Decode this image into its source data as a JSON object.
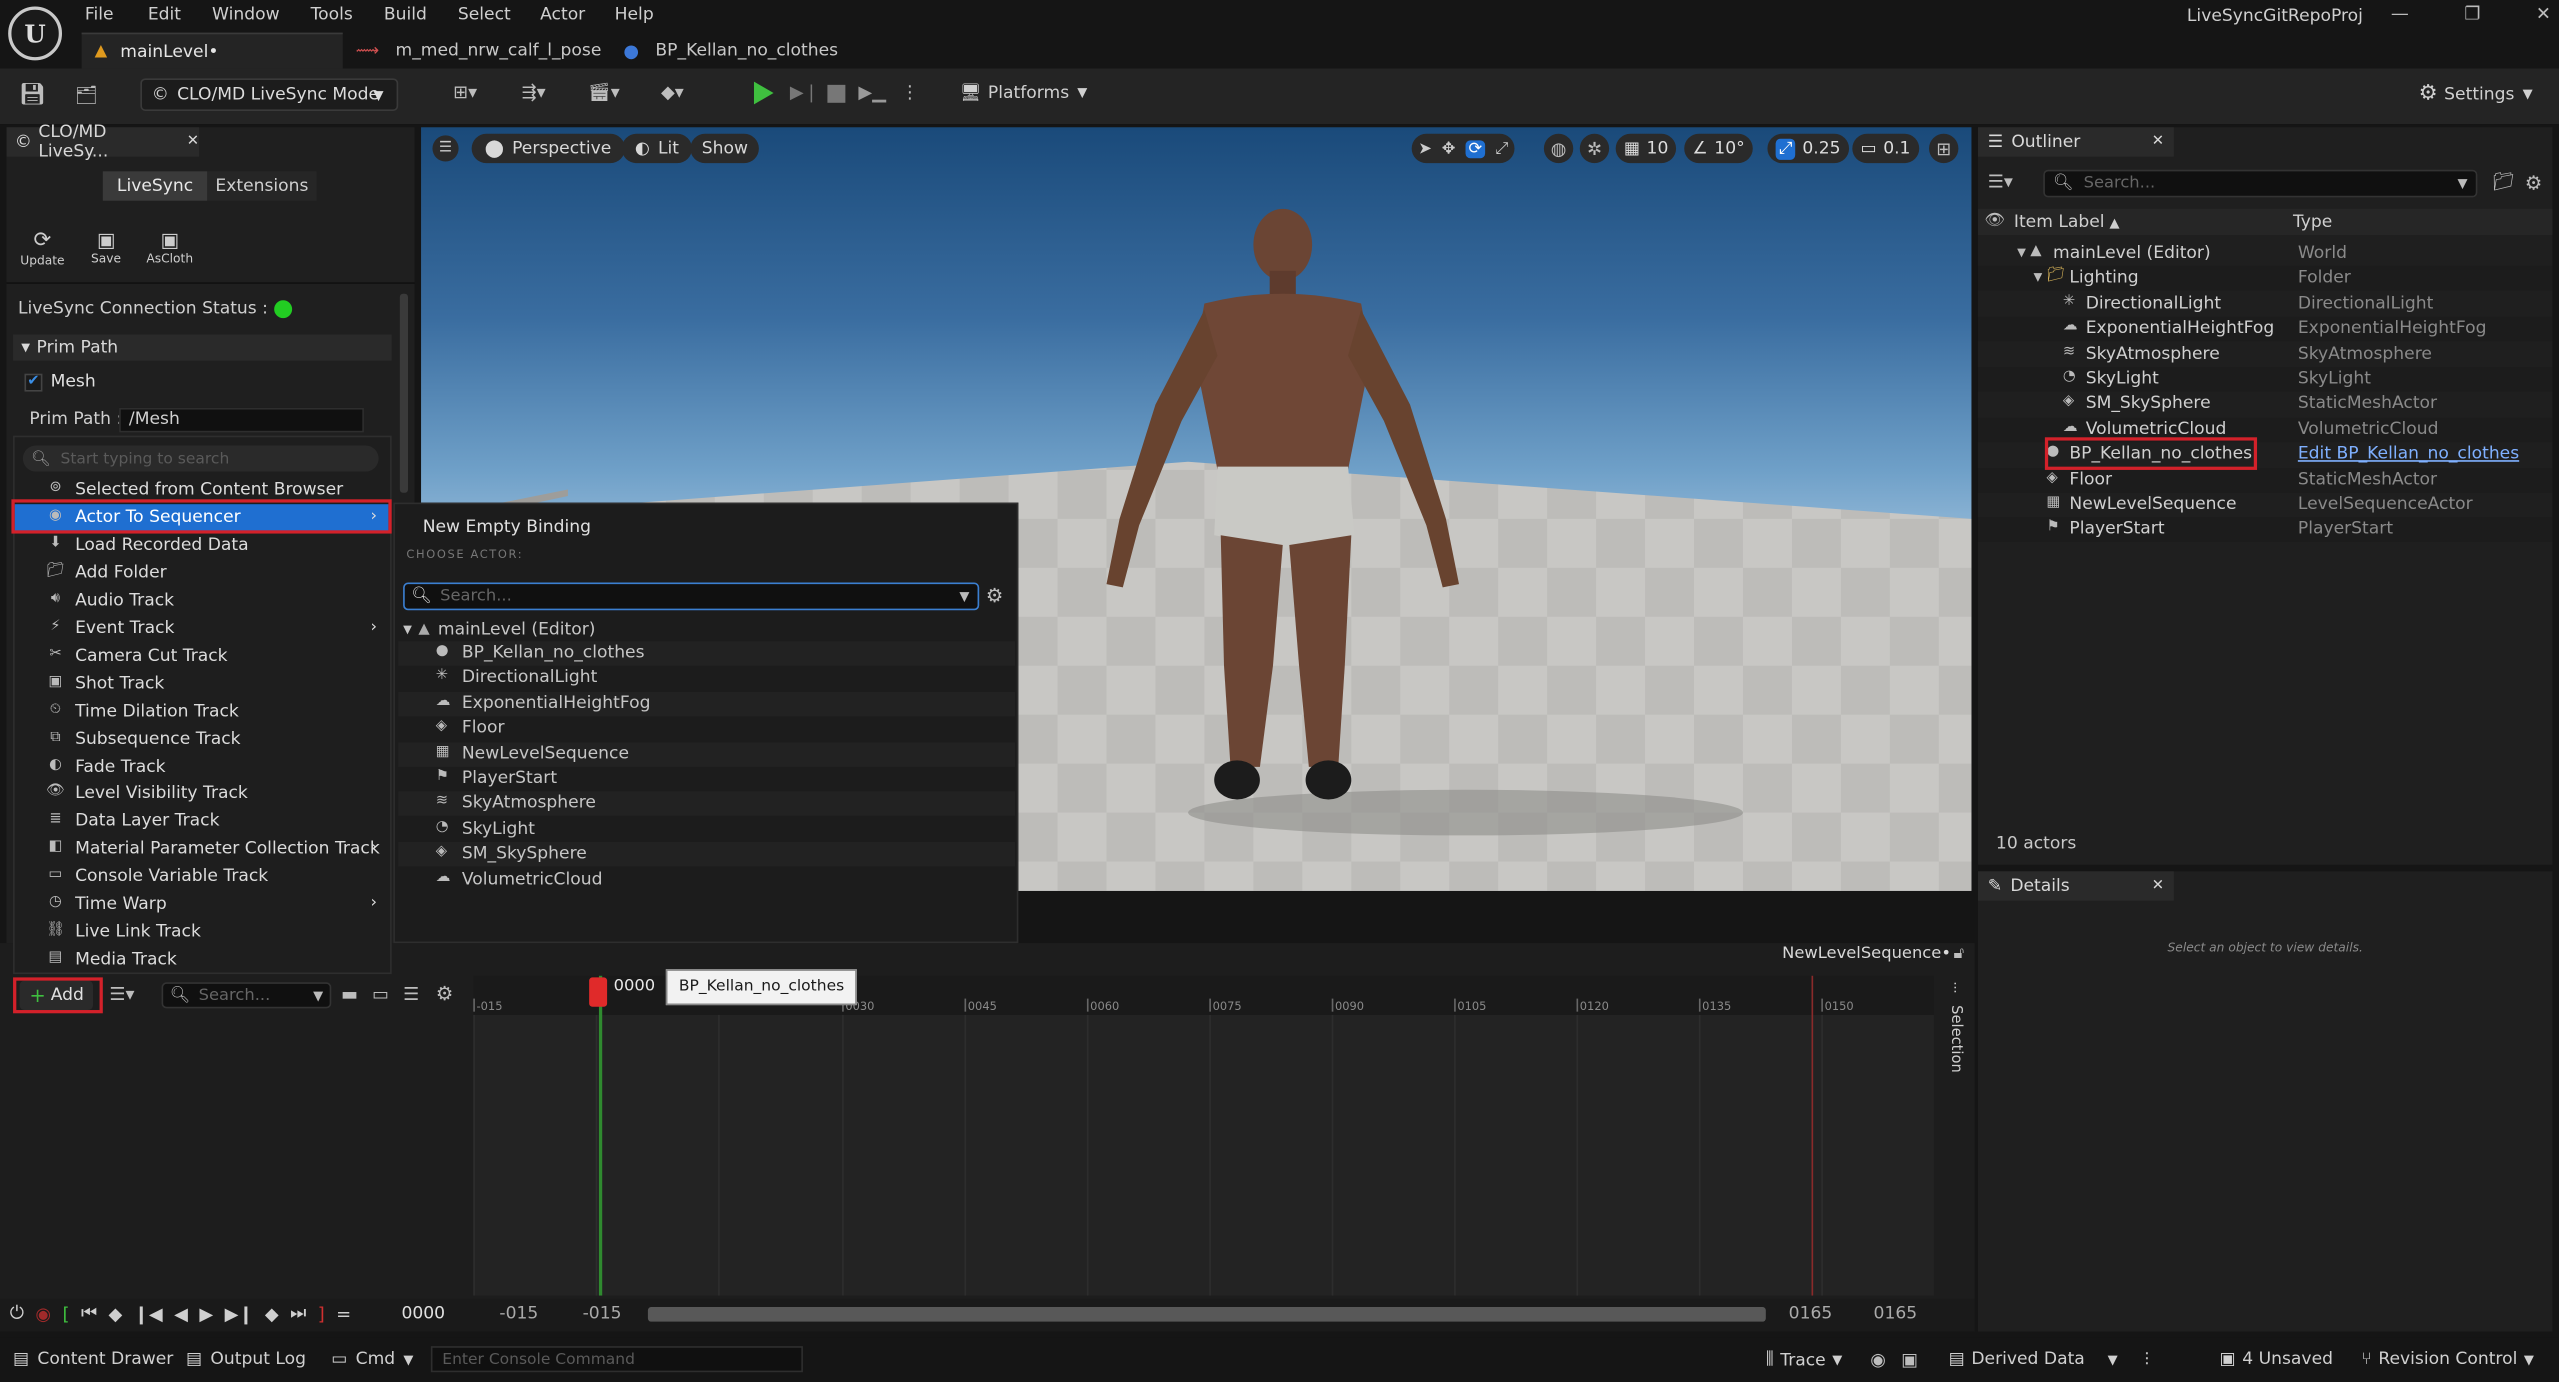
{
  "menubar": {
    "items": [
      "File",
      "Edit",
      "Window",
      "Tools",
      "Build",
      "Select",
      "Actor",
      "Help"
    ],
    "project": "LiveSyncGitRepoProj"
  },
  "tabs": [
    {
      "label": "mainLevel•"
    },
    {
      "label": "m_med_nrw_calf_l_pose"
    },
    {
      "label": "BP_Kellan_no_clothes"
    }
  ],
  "toolbar": {
    "mode": "CLO/MD LiveSync Mode",
    "platforms": "Platforms",
    "settings": "Settings"
  },
  "leftpanel": {
    "title": "CLO/MD LiveSy...",
    "tab_livesync": "LiveSync",
    "tab_extensions": "Extensions",
    "btn_update": "Update",
    "btn_save": "Save",
    "btn_ascloth": "AsCloth",
    "status_label": "LiveSync Connection Status :",
    "status_color": "#22cc22",
    "section": "Prim Path",
    "mesh_label": "Mesh",
    "prim_path_label": "Prim Path :",
    "prim_path_value": "/Mesh"
  },
  "viewport": {
    "perspective": "Perspective",
    "lit": "Lit",
    "show": "Show",
    "grid": "10",
    "angle": "10°",
    "scale": "0.25",
    "camera_speed": "0.1"
  },
  "add_menu": {
    "search_placeholder": "Start typing to search",
    "items": [
      {
        "label": "Selected from Content Browser",
        "icon": "content-browser-icon",
        "sub": false
      },
      {
        "label": "Actor To Sequencer",
        "icon": "actor-icon",
        "sub": true
      },
      {
        "label": "Load Recorded Data",
        "icon": "load-icon",
        "sub": false
      },
      {
        "label": "Add Folder",
        "icon": "folder-icon",
        "sub": false
      },
      {
        "label": "Audio Track",
        "icon": "audio-icon",
        "sub": false
      },
      {
        "label": "Event Track",
        "icon": "event-icon",
        "sub": true
      },
      {
        "label": "Camera Cut Track",
        "icon": "camera-cut-icon",
        "sub": false
      },
      {
        "label": "Shot Track",
        "icon": "shot-icon",
        "sub": false
      },
      {
        "label": "Time Dilation Track",
        "icon": "time-dilation-icon",
        "sub": false
      },
      {
        "label": "Subsequence Track",
        "icon": "subsequence-icon",
        "sub": false
      },
      {
        "label": "Fade Track",
        "icon": "fade-icon",
        "sub": false
      },
      {
        "label": "Level Visibility Track",
        "icon": "visibility-icon",
        "sub": false
      },
      {
        "label": "Data Layer Track",
        "icon": "data-layer-icon",
        "sub": false
      },
      {
        "label": "Material Parameter Collection Track",
        "icon": "material-icon",
        "sub": true
      },
      {
        "label": "Console Variable Track",
        "icon": "console-icon",
        "sub": false
      },
      {
        "label": "Time Warp",
        "icon": "time-warp-icon",
        "sub": true
      },
      {
        "label": "Live Link Track",
        "icon": "live-link-icon",
        "sub": false
      },
      {
        "label": "Media Track",
        "icon": "media-icon",
        "sub": false
      }
    ]
  },
  "actor_submenu": {
    "new_binding": "New Empty Binding",
    "choose_actor": "CHOOSE ACTOR:",
    "search_placeholder": "Search...",
    "root": "mainLevel (Editor)",
    "actors": [
      "BP_Kellan_no_clothes",
      "DirectionalLight",
      "ExponentialHeightFog",
      "Floor",
      "NewLevelSequence",
      "PlayerStart",
      "SkyAtmosphere",
      "SkyLight",
      "SM_SkySphere",
      "VolumetricCloud"
    ]
  },
  "outliner": {
    "title": "Outliner",
    "search_placeholder": "Search...",
    "col_label": "Item Label",
    "col_type": "Type",
    "rows": [
      {
        "label": "mainLevel (Editor)",
        "type": "World",
        "indent": 0,
        "icon": "level-icon"
      },
      {
        "label": "Lighting",
        "type": "Folder",
        "indent": 1,
        "icon": "folder-icon"
      },
      {
        "label": "DirectionalLight",
        "type": "DirectionalLight",
        "indent": 2,
        "icon": "sun-icon"
      },
      {
        "label": "ExponentialHeightFog",
        "type": "ExponentialHeightFog",
        "indent": 2,
        "icon": "fog-icon"
      },
      {
        "label": "SkyAtmosphere",
        "type": "SkyAtmosphere",
        "indent": 2,
        "icon": "atmosphere-icon"
      },
      {
        "label": "SkyLight",
        "type": "SkyLight",
        "indent": 2,
        "icon": "skylight-icon"
      },
      {
        "label": "SM_SkySphere",
        "type": "StaticMeshActor",
        "indent": 2,
        "icon": "mesh-icon"
      },
      {
        "label": "VolumetricCloud",
        "type": "VolumetricCloud",
        "indent": 2,
        "icon": "cloud-icon"
      },
      {
        "label": "BP_Kellan_no_clothes",
        "type": "Edit BP_Kellan_no_clothes",
        "indent": 1,
        "icon": "blueprint-icon",
        "link": true
      },
      {
        "label": "Floor",
        "type": "StaticMeshActor",
        "indent": 1,
        "icon": "mesh-icon"
      },
      {
        "label": "NewLevelSequence",
        "type": "LevelSequenceActor",
        "indent": 1,
        "icon": "sequence-icon"
      },
      {
        "label": "PlayerStart",
        "type": "PlayerStart",
        "indent": 1,
        "icon": "player-start-icon"
      }
    ],
    "count": "10 actors"
  },
  "details": {
    "title": "Details",
    "empty": "Select an object to view details."
  },
  "sequencer": {
    "add": "Add",
    "search_placeholder": "Search...",
    "sequence_name": "NewLevelSequence•",
    "current_frame": "0000",
    "tooltip": "BP_Kellan_no_clothes",
    "ticks": [
      "-015",
      "0030",
      "0045",
      "0060",
      "0075",
      "0090",
      "0105",
      "0120",
      "0135",
      "0150"
    ],
    "selection": "Selection",
    "frame_field": "0000",
    "start1": "-015",
    "start2": "-015",
    "end1": "0165",
    "end2": "0165"
  },
  "statusbar": {
    "content_drawer": "Content Drawer",
    "output_log": "Output Log",
    "cmd": "Cmd",
    "console_placeholder": "Enter Console Command",
    "trace": "Trace",
    "derived_data": "Derived Data",
    "unsaved": "4 Unsaved",
    "revision": "Revision Control"
  }
}
